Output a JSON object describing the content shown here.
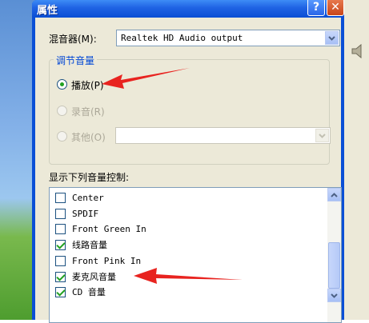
{
  "window": {
    "title": "属性",
    "help_label": "?",
    "close_label": "✕"
  },
  "mixer": {
    "label": "混音器(M):",
    "value": "Realtek HD Audio output"
  },
  "adjust_volume": {
    "title": "调节音量",
    "options": [
      {
        "label": "播放(P)",
        "checked": true,
        "enabled": true
      },
      {
        "label": "录音(R)",
        "checked": false,
        "enabled": false
      },
      {
        "label": "其他(O)",
        "checked": false,
        "enabled": false
      }
    ]
  },
  "controls": {
    "label": "显示下列音量控制:",
    "items": [
      {
        "label": "Center",
        "checked": false
      },
      {
        "label": "SPDIF",
        "checked": false
      },
      {
        "label": "Front Green In",
        "checked": false
      },
      {
        "label": "线路音量",
        "checked": true
      },
      {
        "label": "Front Pink In",
        "checked": false
      },
      {
        "label": "麦克风音量",
        "checked": true
      },
      {
        "label": "CD 音量",
        "checked": true
      }
    ]
  },
  "colors": {
    "annotation_arrow": "#e8231f",
    "title_bar": "#0a4ed4",
    "group_title": "#0046d5"
  }
}
